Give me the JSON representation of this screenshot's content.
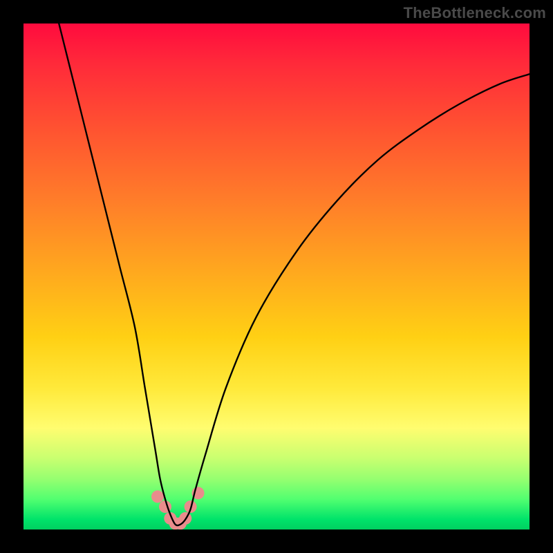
{
  "watermark": "TheBottleneck.com",
  "chart_data": {
    "type": "line",
    "title": "",
    "xlabel": "",
    "ylabel": "",
    "xlim": [
      0,
      100
    ],
    "ylim": [
      0,
      100
    ],
    "series": [
      {
        "name": "bottleneck-curve",
        "x": [
          7,
          10,
          13,
          16,
          19,
          22,
          24,
          26,
          27,
          28,
          29,
          30,
          31,
          32,
          33,
          34,
          36,
          40,
          46,
          54,
          62,
          70,
          78,
          86,
          94,
          100
        ],
        "values": [
          100,
          88,
          76,
          64,
          52,
          40,
          28,
          16,
          10,
          6,
          3,
          1,
          1,
          2,
          4,
          8,
          15,
          28,
          42,
          55,
          65,
          73,
          79,
          84,
          88,
          90
        ]
      }
    ],
    "markers": {
      "name": "trough-markers",
      "x": [
        26.5,
        28,
        29,
        30,
        31,
        32,
        33,
        34.5
      ],
      "values": [
        6.5,
        4.5,
        2.2,
        1.2,
        1.2,
        2.2,
        4.5,
        7.2
      ],
      "color": "#e98c8c",
      "radius": 9
    },
    "gradient_stops": [
      {
        "pos": 0,
        "color": "#ff0b3e"
      },
      {
        "pos": 8,
        "color": "#ff2a3a"
      },
      {
        "pos": 22,
        "color": "#ff5630"
      },
      {
        "pos": 34,
        "color": "#ff7a2a"
      },
      {
        "pos": 48,
        "color": "#ffa51f"
      },
      {
        "pos": 62,
        "color": "#ffd014"
      },
      {
        "pos": 72,
        "color": "#ffe93a"
      },
      {
        "pos": 80,
        "color": "#fffd70"
      },
      {
        "pos": 86,
        "color": "#c8ff70"
      },
      {
        "pos": 90,
        "color": "#96ff70"
      },
      {
        "pos": 94,
        "color": "#52ff70"
      },
      {
        "pos": 98,
        "color": "#00e36a"
      },
      {
        "pos": 100,
        "color": "#00d060"
      }
    ]
  }
}
